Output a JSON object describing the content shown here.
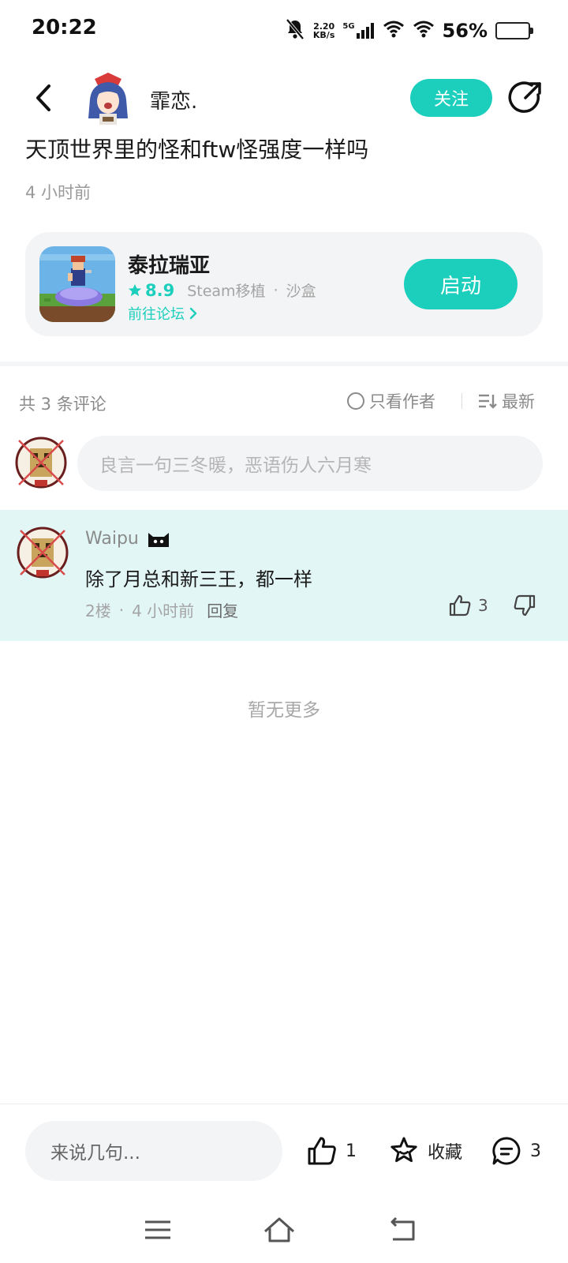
{
  "status_bar": {
    "time": "20:22",
    "net_speed_value": "2.20",
    "net_speed_unit": "KB/s",
    "network_type": "5G",
    "battery_percent": "56%",
    "battery_level": 0.56
  },
  "header": {
    "author_name": "霏恋.",
    "follow_label": "关注"
  },
  "post": {
    "title": "天顶世界里的怪和ftw怪强度一样吗",
    "time": "4 小时前"
  },
  "game": {
    "name": "泰拉瑞亚",
    "rating": "8.9",
    "platform": "Steam移植",
    "separator": "·",
    "genre": "沙盒",
    "forum_link": "前往论坛",
    "launch_label": "启动"
  },
  "comments_section": {
    "count_label": "共 3 条评论",
    "author_only_label": "只看作者",
    "sort_label": "最新",
    "input_placeholder": "良言一句三冬暖，恶语伤人六月寒"
  },
  "comment": {
    "username": "Waipu",
    "text": "除了月总和新三王，都一样",
    "floor": "2楼",
    "separator": "·",
    "time": "4 小时前",
    "reply_label": "回复",
    "like_count": "3"
  },
  "no_more_label": "暂无更多",
  "bottom_bar": {
    "input_placeholder": "来说几句...",
    "like_count": "1",
    "favorite_label": "收藏",
    "comment_count": "3"
  },
  "colors": {
    "accent": "#1ccfbd",
    "highlight_bg": "#e3f6f6"
  }
}
